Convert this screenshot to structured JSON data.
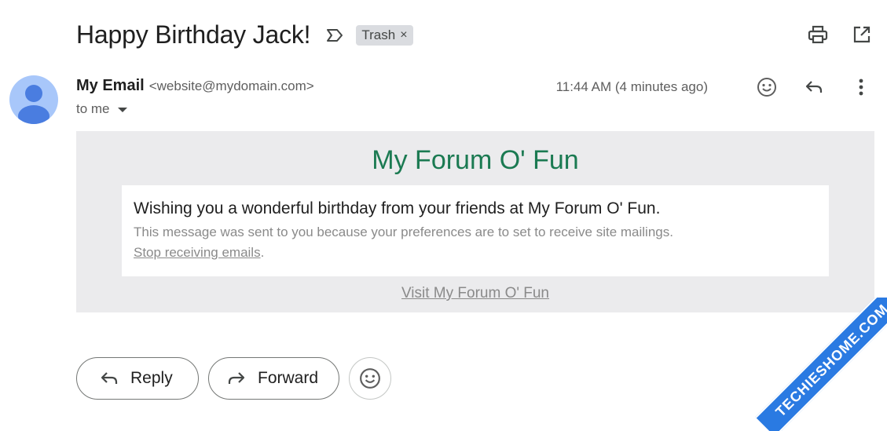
{
  "subject": {
    "title": "Happy Birthday Jack!",
    "label": "Trash",
    "label_close": "×"
  },
  "sender": {
    "name": "My Email",
    "address": "<website@mydomain.com>",
    "to": "to me",
    "timestamp": "11:44 AM (4 minutes ago)"
  },
  "email": {
    "forum_title": "My Forum O' Fun",
    "message": "Wishing you a wonderful birthday from your friends at My Forum O' Fun.",
    "note": "This message was sent to you because your preferences are to set to receive site mailings.",
    "stop_link": "Stop receiving emails",
    "stop_suffix": ".",
    "visit_link": "Visit My Forum O' Fun"
  },
  "actions": {
    "reply": "Reply",
    "forward": "Forward"
  },
  "watermark": "TECHIESHOME.COM",
  "colors": {
    "forum_title": "#1b7a52",
    "body_bg": "#ebebed",
    "avatar_bg": "#a8c7fa",
    "avatar_fg": "#4a7de0",
    "watermark_bg": "#2a7ae2"
  },
  "icons": {
    "important": "important-marker-icon",
    "print": "print-icon",
    "open_new": "open-in-new-window-icon",
    "emoji": "emoji-reaction-icon",
    "reply": "reply-icon",
    "more": "more-vertical-icon",
    "forward": "forward-icon",
    "caret": "caret-down-icon"
  }
}
